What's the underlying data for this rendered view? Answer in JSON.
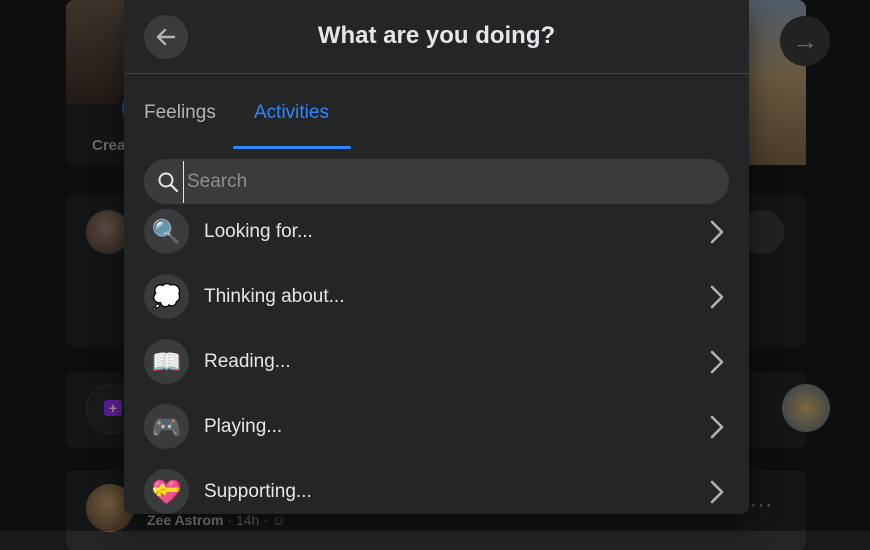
{
  "background": {
    "create_story_label": "Crea",
    "post_byline": {
      "author": "Zee Astrom",
      "time": "14h"
    },
    "more_icon": "more-horizontal-icon",
    "next_icon": "arrow-right-icon"
  },
  "modal": {
    "title": "What are you doing?",
    "back_icon": "arrow-left-icon",
    "tabs": [
      {
        "label": "Feelings",
        "active": false
      },
      {
        "label": "Activities",
        "active": true
      }
    ],
    "search": {
      "placeholder": "Search",
      "value": "",
      "icon": "search-icon"
    },
    "activities": [
      {
        "label": "Looking for...",
        "icon": "magnifying-glass-icon",
        "glyph": "🔍"
      },
      {
        "label": "Thinking about...",
        "icon": "thought-bubble-icon",
        "glyph": "💭"
      },
      {
        "label": "Reading...",
        "icon": "open-book-icon",
        "glyph": "📖"
      },
      {
        "label": "Playing...",
        "icon": "game-controller-icon",
        "glyph": "🎮"
      },
      {
        "label": "Supporting...",
        "icon": "hand-heart-icon",
        "glyph": "💝"
      }
    ],
    "item_chevron_icon": "chevron-right-icon"
  },
  "colors": {
    "accent": "#2d88ff",
    "modal_bg": "#242526",
    "page_bg": "#18191a",
    "secondary_text": "#b0b3b8"
  }
}
